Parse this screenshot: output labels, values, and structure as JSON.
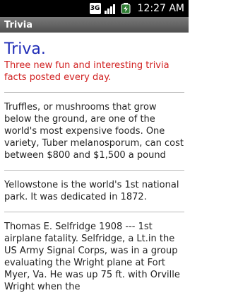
{
  "status_bar": {
    "network": "3G",
    "time": "12:27 AM"
  },
  "title_bar": {
    "title": "Trivia"
  },
  "main": {
    "heading": "Triva.",
    "subtitle": "Three new fun and interesting trivia facts posted every day.",
    "facts": [
      "Truffles, or mushrooms that grow below the ground, are one of the world's most expensive foods. One variety, Tuber melanosporum, can cost between $800 and $1,500 a pound",
      "Yellowstone is the world's 1st national park. It was dedicated in 1872.",
      "Thomas E. Selfridge 1908 --- 1st airplane fatality. Selfridge, a Lt.in the US Army Signal Corps, was in a group evaluating the Wright plane at Fort Myer, Va. He was up 75 ft. with Orville Wright when the"
    ]
  },
  "colors": {
    "heading": "#1f2cb7",
    "subtitle": "#d12222"
  },
  "icons": [
    "3g-icon",
    "signal-icon",
    "battery-icon"
  ]
}
